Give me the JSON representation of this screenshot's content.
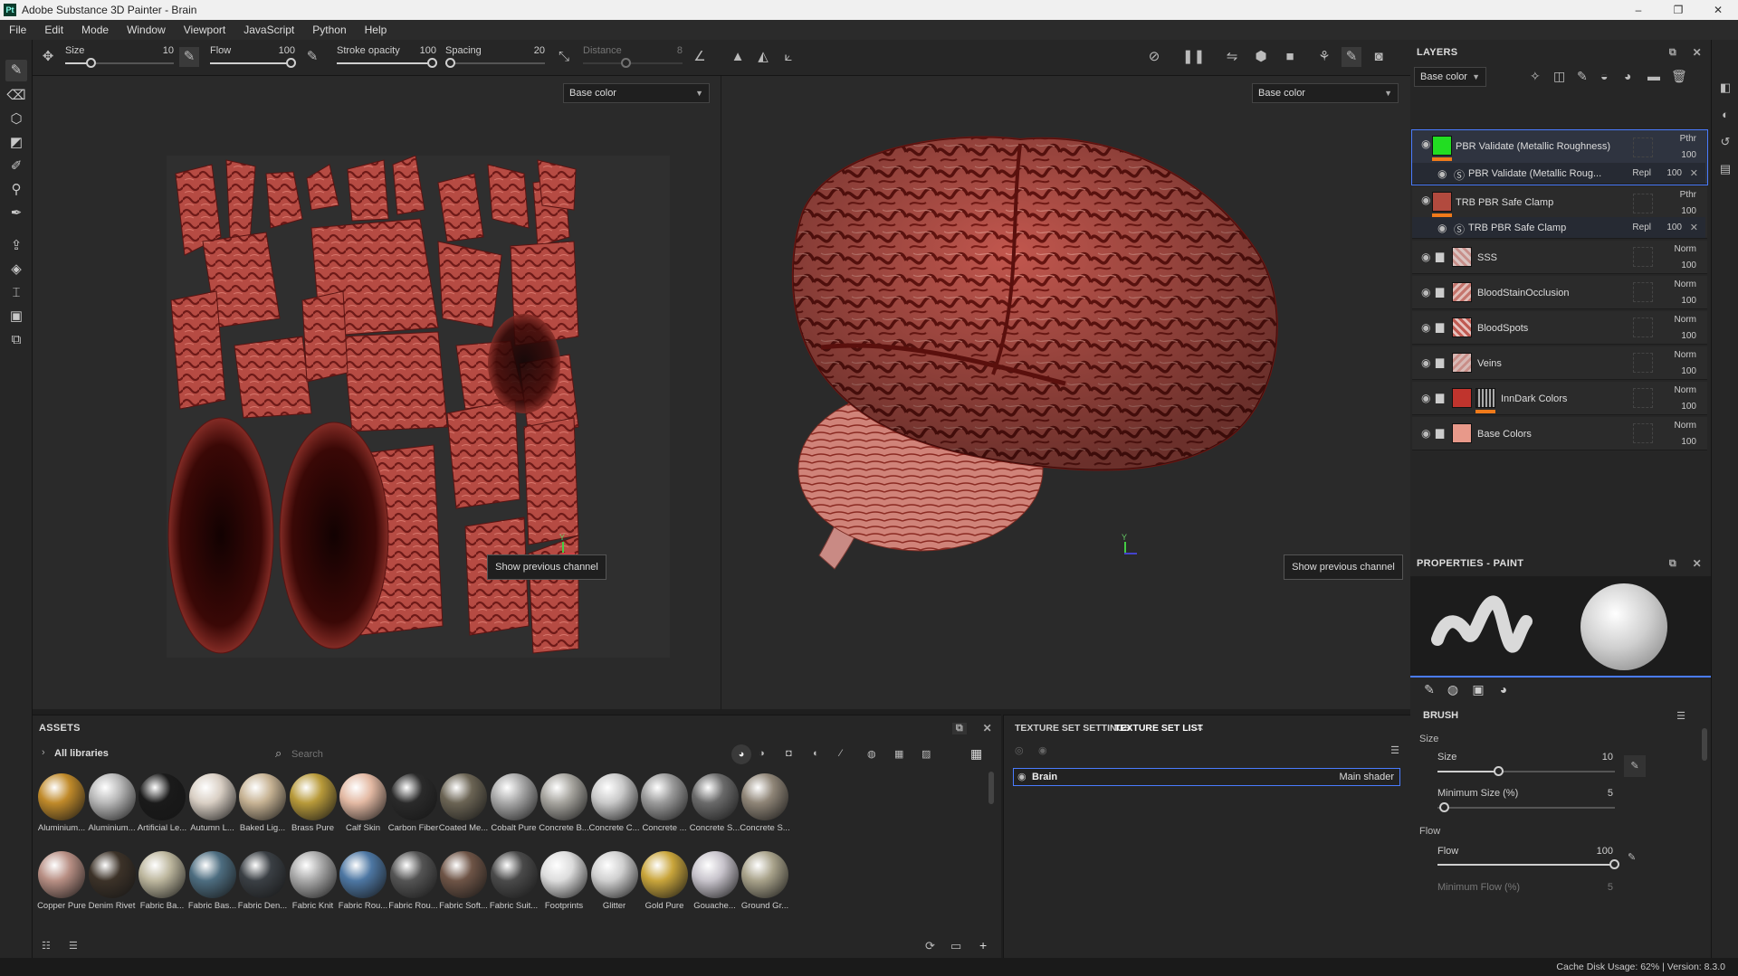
{
  "window": {
    "title": "Adobe Substance 3D Painter - Brain",
    "logo": "Pt",
    "controls": [
      "–",
      "❐",
      "✕"
    ]
  },
  "menu": [
    "File",
    "Edit",
    "Mode",
    "Window",
    "Viewport",
    "JavaScript",
    "Python",
    "Help"
  ],
  "toolbar": {
    "size_label": "Size",
    "size_value": "10",
    "flow_label": "Flow",
    "flow_value": "100",
    "stroke_opacity_label": "Stroke opacity",
    "stroke_opacity_value": "100",
    "spacing_label": "Spacing",
    "spacing_value": "20",
    "distance_label": "Distance",
    "distance_value": "8"
  },
  "viewport": {
    "channel_2d": "Base color",
    "channel_3d": "Base color",
    "show_previous_2d": "Show previous channel",
    "show_previous_3d": "Show previous channel",
    "axis_y": "Y"
  },
  "layers": {
    "title": "LAYERS",
    "channel": "Base color",
    "rows": [
      {
        "name": "PBR Validate (Metallic Roughness)",
        "blend": "Pthr",
        "opacity": "100",
        "swatch": "#22dd22"
      },
      {
        "name": "PBR Validate (Metallic Roug...",
        "blend": "Repl",
        "opacity": "100"
      },
      {
        "name": "TRB PBR Safe Clamp",
        "blend": "Pthr",
        "opacity": "100",
        "swatch": "#b24a3e"
      },
      {
        "name": "TRB PBR Safe Clamp",
        "blend": "Repl",
        "opacity": "100"
      },
      {
        "name": "SSS",
        "blend": "Norm",
        "opacity": "100"
      },
      {
        "name": "BloodStainOcclusion",
        "blend": "Norm",
        "opacity": "100"
      },
      {
        "name": "BloodSpots",
        "blend": "Norm",
        "opacity": "100"
      },
      {
        "name": "Veins",
        "blend": "Norm",
        "opacity": "100"
      },
      {
        "name": "InnDark Colors",
        "blend": "Norm",
        "opacity": "100"
      },
      {
        "name": "Base Colors",
        "blend": "Norm",
        "opacity": "100"
      }
    ]
  },
  "properties": {
    "title": "PROPERTIES - PAINT",
    "brush_title": "BRUSH",
    "size_group": "Size",
    "size_label": "Size",
    "size_value": "10",
    "min_size_label": "Minimum Size (%)",
    "min_size_value": "5",
    "flow_group": "Flow",
    "flow_label": "Flow",
    "flow_value": "100",
    "min_flow_label": "Minimum Flow (%)",
    "min_flow_value": "5"
  },
  "assets": {
    "title": "ASSETS",
    "library": "All libraries",
    "search_placeholder": "Search",
    "materials": [
      {
        "name": "Aluminium...",
        "color": "#c08a2a"
      },
      {
        "name": "Aluminium...",
        "color": "#b8b8b8"
      },
      {
        "name": "Artificial Le...",
        "color": "#1a1a1a"
      },
      {
        "name": "Autumn L...",
        "color": "#d9cfc4"
      },
      {
        "name": "Baked Lig...",
        "color": "#c7b394"
      },
      {
        "name": "Brass Pure",
        "color": "#b89a3a"
      },
      {
        "name": "Calf Skin",
        "color": "#e3b9a3"
      },
      {
        "name": "Carbon Fiber",
        "color": "#2a2a2a"
      },
      {
        "name": "Coated Me...",
        "color": "#6b6454"
      },
      {
        "name": "Cobalt Pure",
        "color": "#a8a8a8"
      },
      {
        "name": "Concrete B...",
        "color": "#a6a49e"
      },
      {
        "name": "Concrete C...",
        "color": "#c9c9c9"
      },
      {
        "name": "Concrete ...",
        "color": "#9a9a9a"
      },
      {
        "name": "Concrete S...",
        "color": "#6a6a6a"
      },
      {
        "name": "Concrete S...",
        "color": "#8f8577"
      },
      {
        "name": "Copper Pure",
        "color": "#b88f84"
      },
      {
        "name": "Denim Rivet",
        "color": "#3c3228"
      },
      {
        "name": "Fabric Ba...",
        "color": "#bdb79e"
      },
      {
        "name": "Fabric Bas...",
        "color": "#4d6d80"
      },
      {
        "name": "Fabric Den...",
        "color": "#3a3f44"
      },
      {
        "name": "Fabric Knit",
        "color": "#a8a8a8"
      },
      {
        "name": "Fabric Rou...",
        "color": "#4d77a3"
      },
      {
        "name": "Fabric Rou...",
        "color": "#545454"
      },
      {
        "name": "Fabric Soft...",
        "color": "#6e5446"
      },
      {
        "name": "Fabric Suit...",
        "color": "#4a4a4a"
      },
      {
        "name": "Footprints",
        "color": "#dcdcdc"
      },
      {
        "name": "Glitter",
        "color": "#cfcfcf"
      },
      {
        "name": "Gold Pure",
        "color": "#c9a53b"
      },
      {
        "name": "Gouache...",
        "color": "#c7c3cb"
      },
      {
        "name": "Ground Gr...",
        "color": "#a8a28a"
      }
    ]
  },
  "texture_set": {
    "tab_settings": "TEXTURE SET SETTINGS",
    "tab_list": "TEXTURE SET LIST",
    "item_name": "Brain",
    "item_shader": "Main shader"
  },
  "status": {
    "text": "Cache Disk Usage:   62% | Version: 8.3.0"
  },
  "colors": {
    "accent": "#4a7cff",
    "orange": "#f07a1a",
    "flesh": "#b24a3e"
  }
}
